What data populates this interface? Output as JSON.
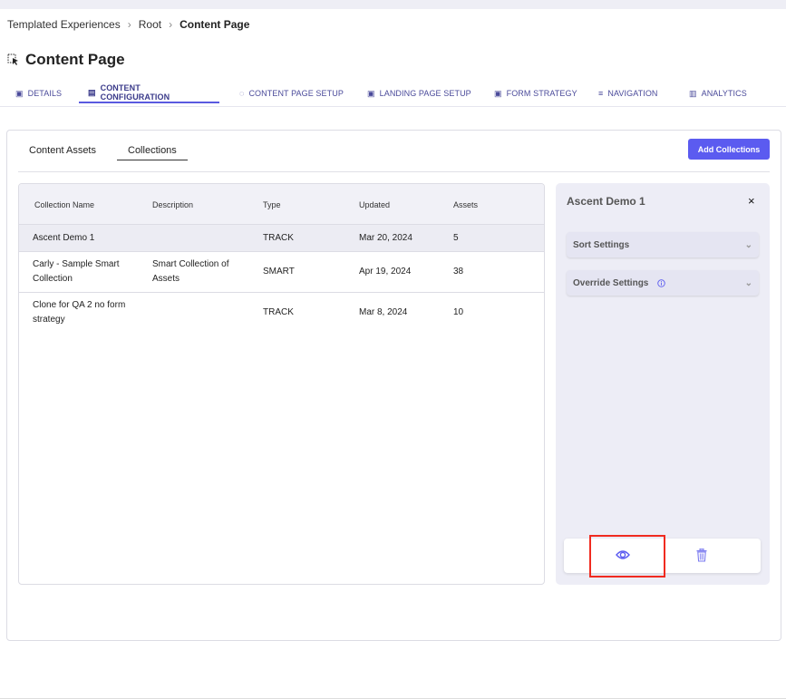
{
  "breadcrumb": [
    "Templated Experiences",
    "Root",
    "Content Page"
  ],
  "page_title": "Content Page",
  "tabs": [
    {
      "label": "DETAILS",
      "icon": "image-icon"
    },
    {
      "label": "CONTENT CONFIGURATION",
      "icon": "document-icon",
      "active": true
    },
    {
      "label": "CONTENT PAGE SETUP",
      "icon": "palette-icon"
    },
    {
      "label": "LANDING PAGE SETUP",
      "icon": "page-icon"
    },
    {
      "label": "FORM STRATEGY",
      "icon": "form-icon"
    },
    {
      "label": "NAVIGATION",
      "icon": "menu-icon"
    },
    {
      "label": "ANALYTICS",
      "icon": "bar-chart-icon"
    }
  ],
  "subtabs": [
    "Content Assets",
    "Collections"
  ],
  "active_subtab": "Collections",
  "add_button": "Add Collections",
  "table": {
    "headers": [
      "Collection Name",
      "Description",
      "Type",
      "Updated",
      "Assets"
    ],
    "rows": [
      [
        "Ascent Demo 1",
        "",
        "TRACK",
        "Mar 20, 2024",
        "5"
      ],
      [
        "Carly - Sample Smart Collection",
        "Smart Collection of Assets",
        "SMART",
        "Apr 19, 2024",
        "38"
      ],
      [
        "Clone for QA 2 no form strategy",
        "",
        "TRACK",
        "Mar 8, 2024",
        "10"
      ]
    ]
  },
  "panel": {
    "title": "Ascent Demo 1",
    "close": "×",
    "sort": "Sort Settings",
    "override": "Override Settings"
  },
  "colors": {
    "accent": "#5b5bf0",
    "panel_bg": "#ededf6",
    "highlight": "#f02b20"
  }
}
